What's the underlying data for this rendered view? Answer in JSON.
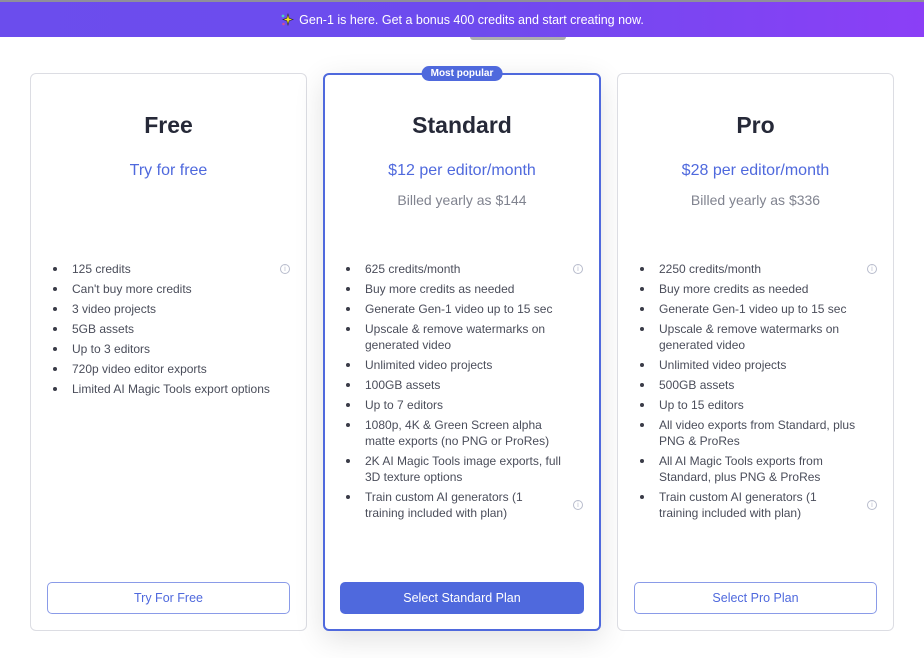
{
  "banner": {
    "icon": "sparkle-icon",
    "text": "Gen-1 is here. Get a bonus 400 credits and start creating now."
  },
  "colors": {
    "accent": "#4f69dd",
    "banner_start": "#6b4ded",
    "banner_end": "#8b3ff6"
  },
  "plans": [
    {
      "name": "Free",
      "price": "Try for free",
      "billed": "",
      "features": [
        {
          "text": "125 credits",
          "info": true
        },
        {
          "text": "Can't buy more credits",
          "info": false
        },
        {
          "text": "3 video projects",
          "info": false
        },
        {
          "text": "5GB assets",
          "info": false
        },
        {
          "text": "Up to 3 editors",
          "info": false
        },
        {
          "text": "720p video editor exports",
          "info": false
        },
        {
          "text": "Limited AI Magic Tools export options",
          "info": false
        }
      ],
      "cta": "Try For Free"
    },
    {
      "name": "Standard",
      "badge": "Most popular",
      "price": "$12 per editor/month",
      "billed": "Billed yearly as $144",
      "features": [
        {
          "text": "625 credits/month",
          "info": true
        },
        {
          "text": "Buy more credits as needed",
          "info": false
        },
        {
          "text": "Generate Gen-1 video up to 15 sec",
          "info": false
        },
        {
          "text": "Upscale & remove watermarks on generated video",
          "info": false
        },
        {
          "text": "Unlimited video projects",
          "info": false
        },
        {
          "text": "100GB assets",
          "info": false
        },
        {
          "text": "Up to 7 editors",
          "info": false
        },
        {
          "text": "1080p, 4K & Green Screen alpha matte exports (no PNG or ProRes)",
          "info": false
        },
        {
          "text": "2K AI Magic Tools image exports, full 3D texture options",
          "info": false
        },
        {
          "text": "Train custom AI generators (1 training included with plan)",
          "info": true
        }
      ],
      "cta": "Select Standard Plan"
    },
    {
      "name": "Pro",
      "price": "$28 per editor/month",
      "billed": "Billed yearly as $336",
      "features": [
        {
          "text": "2250 credits/month",
          "info": true
        },
        {
          "text": "Buy more credits as needed",
          "info": false
        },
        {
          "text": "Generate Gen-1 video up to 15 sec",
          "info": false
        },
        {
          "text": "Upscale & remove watermarks on generated video",
          "info": false
        },
        {
          "text": "Unlimited video projects",
          "info": false
        },
        {
          "text": "500GB assets",
          "info": false
        },
        {
          "text": "Up to 15 editors",
          "info": false
        },
        {
          "text": "All video exports from Standard, plus PNG & ProRes",
          "info": false
        },
        {
          "text": "All AI Magic Tools exports from Standard, plus PNG & ProRes",
          "info": false
        },
        {
          "text": "Train custom AI generators (1 training included with plan)",
          "info": true
        }
      ],
      "cta": "Select Pro Plan"
    }
  ]
}
